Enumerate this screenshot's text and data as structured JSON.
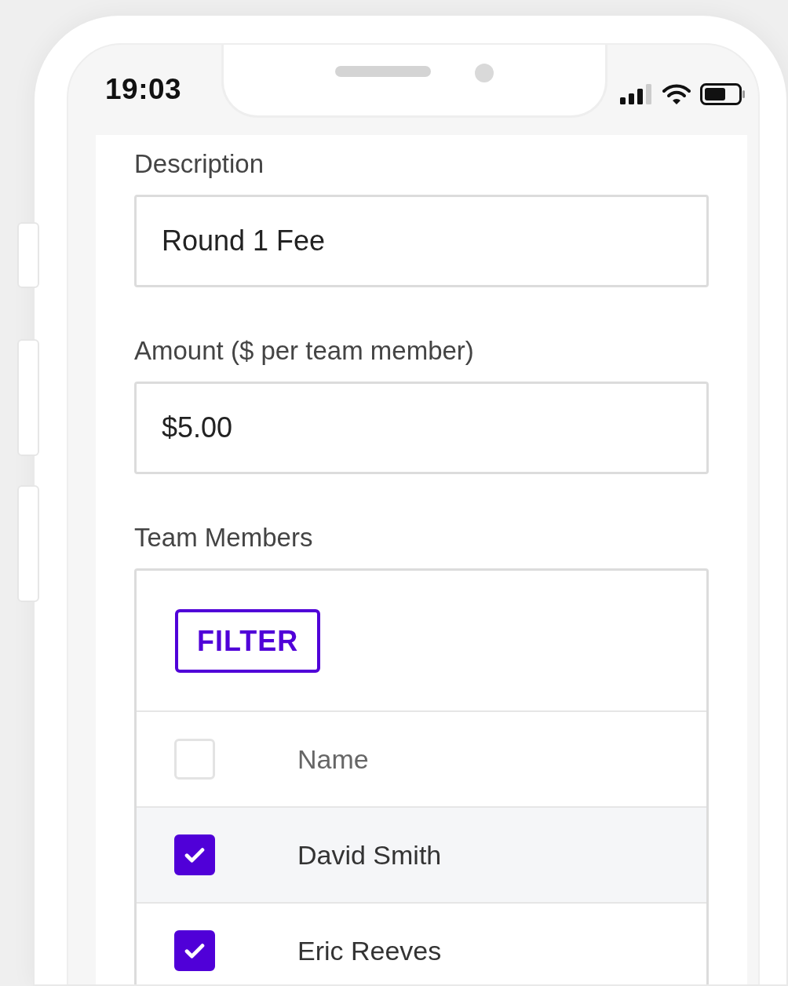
{
  "status_bar": {
    "time": "19:03"
  },
  "form": {
    "fields": [
      {
        "label": "Description",
        "value": "Round 1 Fee"
      },
      {
        "label": "Amount ($ per team member)",
        "value": "$5.00"
      }
    ],
    "team_members": {
      "label": "Team Members",
      "filter_button": "FILTER",
      "table": {
        "header": {
          "label": "Name",
          "checked": false
        },
        "rows": [
          {
            "name": "David Smith",
            "checked": true
          },
          {
            "name": "Eric Reeves",
            "checked": true
          }
        ]
      }
    }
  }
}
